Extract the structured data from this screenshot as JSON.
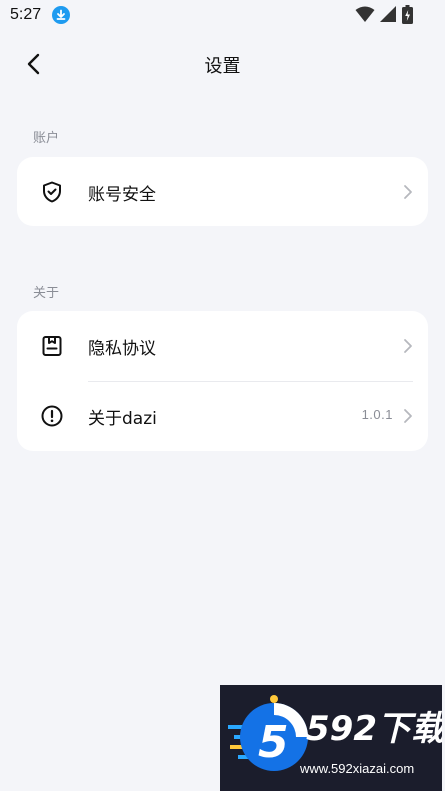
{
  "status_bar": {
    "time": "5:27"
  },
  "header": {
    "title": "设置"
  },
  "sections": [
    {
      "label": "账户",
      "items": [
        {
          "label": "账号安全",
          "icon": "shield-check-icon",
          "value": ""
        }
      ]
    },
    {
      "label": "关于",
      "items": [
        {
          "label": "隐私协议",
          "icon": "document-icon",
          "value": ""
        },
        {
          "label": "关于dazi",
          "icon": "info-circle-icon",
          "value": "1.0.1"
        }
      ]
    }
  ],
  "watermark": {
    "logo_text": "5",
    "title": "592下载",
    "url": "www.592xiazai.com"
  },
  "colors": {
    "background": "#f4f5f9",
    "card": "#ffffff",
    "secondary_text": "#8a8d96",
    "download_badge": "#1e9bf0"
  }
}
